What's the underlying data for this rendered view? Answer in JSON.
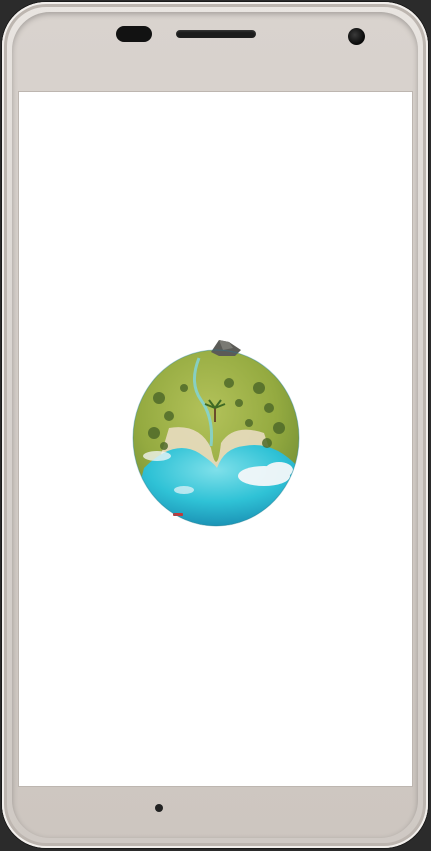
{
  "device": {
    "frame_color": "#d8d2cd",
    "screen_color": "#ffffff"
  },
  "screen": {
    "splash_image": "floating-island-globe",
    "colors": {
      "grass": "#9bb145",
      "water": "#2fc2d6",
      "sand": "#e8dcc0",
      "rock": "#5b5b57",
      "cloud": "#f4f7f9"
    }
  }
}
